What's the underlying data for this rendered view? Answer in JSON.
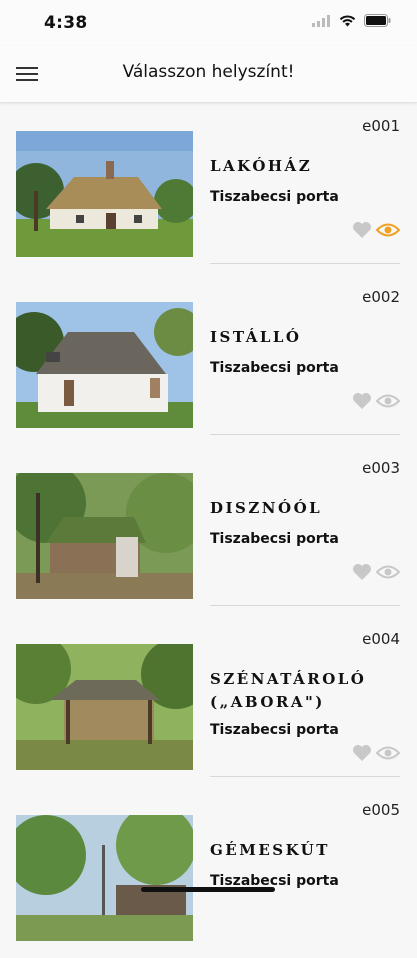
{
  "status_bar": {
    "time": "4:38"
  },
  "header": {
    "title": "Válasszon helyszínt!"
  },
  "colors": {
    "accent": "#f0a020",
    "muted": "#c8c8c8"
  },
  "items": [
    {
      "code": "e001",
      "name": "LAKÓHÁZ",
      "subtitle": "Tiszabecsi porta",
      "icon_heart": "heart-icon",
      "icon_eye": "eye-icon",
      "eye_active": true
    },
    {
      "code": "e002",
      "name": "ISTÁLLÓ",
      "subtitle": "Tiszabecsi porta",
      "icon_heart": "heart-icon",
      "icon_eye": "eye-icon",
      "eye_active": false
    },
    {
      "code": "e003",
      "name": "DISZNÓÓL",
      "subtitle": "Tiszabecsi porta",
      "icon_heart": "heart-icon",
      "icon_eye": "eye-icon",
      "eye_active": false
    },
    {
      "code": "e004",
      "name": "SZÉNATÁROLÓ („ABORA\")",
      "subtitle": "Tiszabecsi porta",
      "icon_heart": "heart-icon",
      "icon_eye": "eye-icon",
      "eye_active": false
    },
    {
      "code": "e005",
      "name": "GÉMESKÚT",
      "subtitle": "Tiszabecsi porta"
    }
  ]
}
